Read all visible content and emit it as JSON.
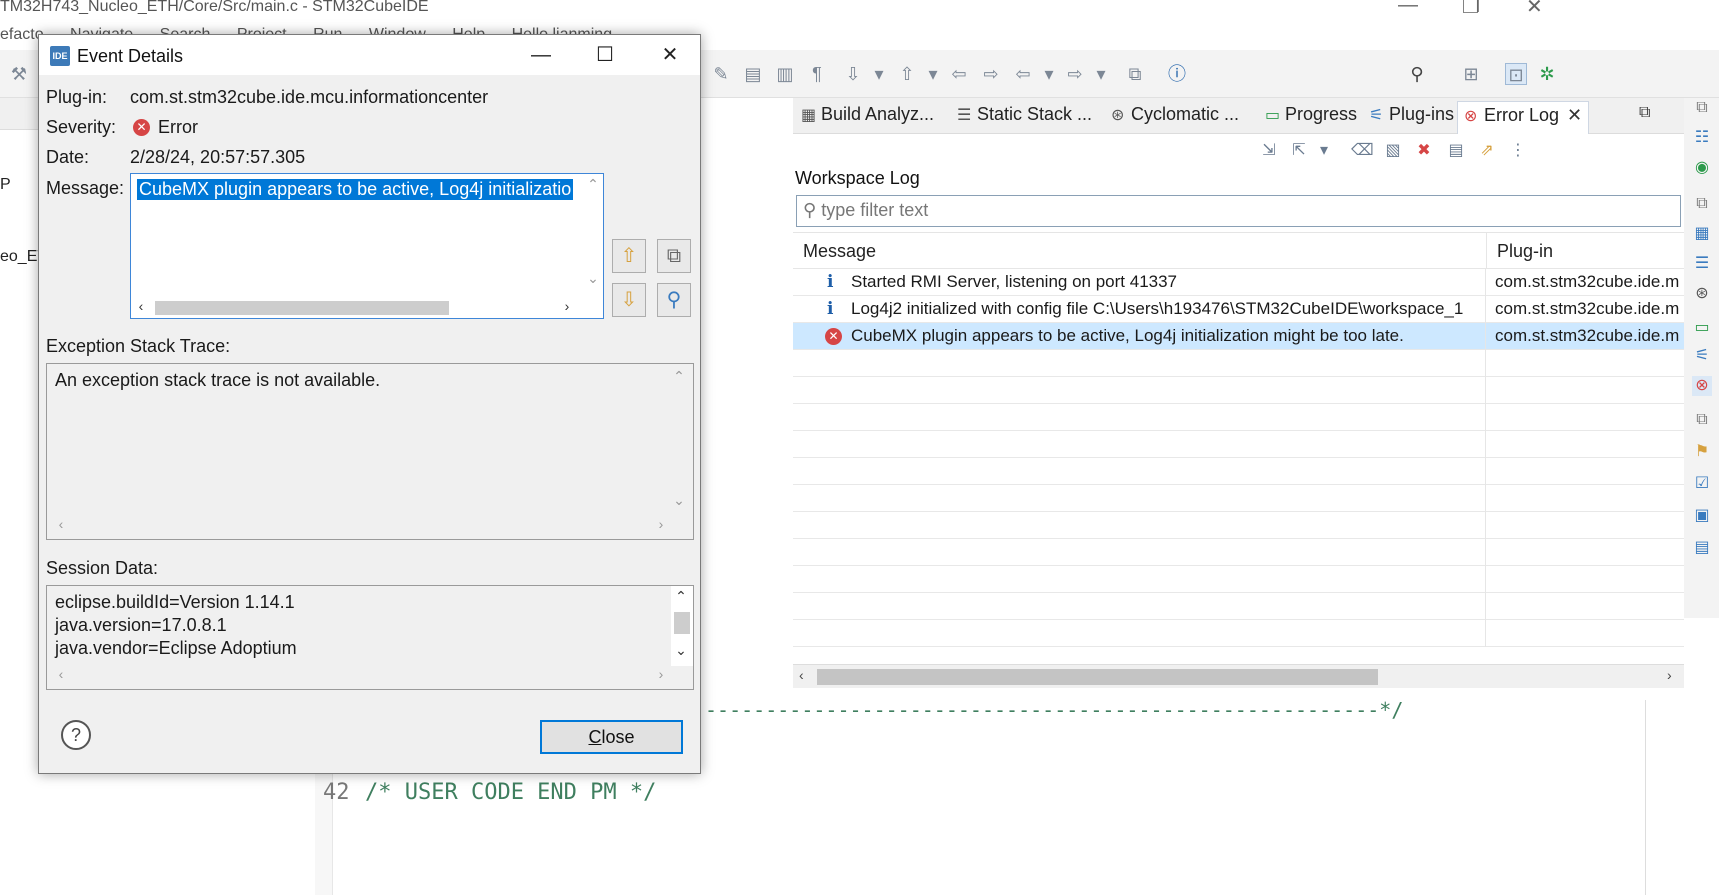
{
  "ide": {
    "window_title": "TM32H743_Nucleo_ETH/Core/Src/main.c - STM32CubeIDE",
    "menu": [
      "efacto",
      "Navigate",
      "Search",
      "Project",
      "Run",
      "Window",
      "Help",
      "Hello lianming"
    ],
    "left_fragments": [
      "P",
      "eo_ET"
    ],
    "editor": {
      "line_number": "42",
      "code_text": "/* USER CODE END PM */",
      "dash_comment": "--------------------------------------------------------*/"
    }
  },
  "error_log": {
    "tabs": [
      {
        "label": "Build Analyz...",
        "icon": "build-analyzer-icon"
      },
      {
        "label": "Static Stack ...",
        "icon": "static-stack-icon"
      },
      {
        "label": "Cyclomatic ...",
        "icon": "cyclomatic-icon"
      },
      {
        "label": "Progress",
        "icon": "progress-icon"
      },
      {
        "label": "Plug-ins",
        "icon": "plugins-icon"
      },
      {
        "label": "Error Log",
        "icon": "error-log-icon"
      }
    ],
    "workspace_title": "Workspace Log",
    "filter_placeholder": "type filter text",
    "columns": [
      "Message",
      "Plug-in"
    ],
    "rows": [
      {
        "message": "Started RMI Server, listening on port 41337",
        "plugin": "com.st.stm32cube.ide.m",
        "severity": "info"
      },
      {
        "message": "Log4j2 initialized with config file C:\\Users\\h193476\\STM32CubeIDE\\workspace_1",
        "plugin": "com.st.stm32cube.ide.m",
        "severity": "info"
      },
      {
        "message": "CubeMX plugin appears to be active, Log4j initialization might be too late.",
        "plugin": "com.st.stm32cube.ide.m",
        "severity": "error"
      }
    ]
  },
  "dialog": {
    "title": "Event Details",
    "logo_text": "IDE",
    "plugin_label": "Plug-in:",
    "plugin_value": "com.st.stm32cube.ide.mcu.informationcenter",
    "severity_label": "Severity:",
    "severity_value": "Error",
    "date_label": "Date:",
    "date_value": "2/28/24, 20:57:57.305",
    "message_label": "Message:",
    "message_value": "CubeMX plugin appears to be active, Log4j initializatio",
    "exception_label": "Exception Stack Trace:",
    "exception_value": "An exception stack trace is not available.",
    "session_label": "Session Data:",
    "session_lines": [
      "eclipse.buildId=Version 1.14.1",
      "java.version=17.0.8.1",
      "java.vendor=Eclipse Adoptium"
    ],
    "close_label_underlined": "C",
    "close_label_rest": "lose",
    "help_label": "?"
  },
  "colors": {
    "selection": "#0078d7",
    "row_selected": "#cde8ff",
    "error_red": "#d64545",
    "info_blue": "#1e5ea8"
  }
}
